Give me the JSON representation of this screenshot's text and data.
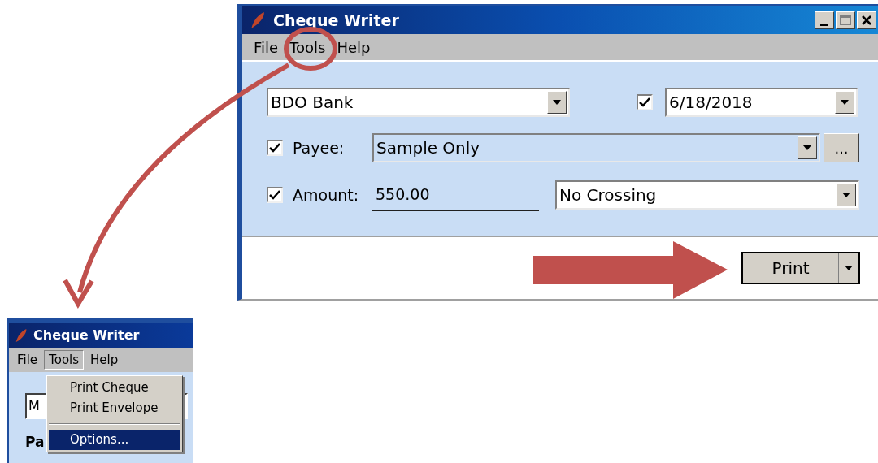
{
  "main_window": {
    "title": "Cheque Writer",
    "menu": [
      {
        "label": "File"
      },
      {
        "label": "Tools"
      },
      {
        "label": "Help"
      }
    ],
    "bank": "BDO Bank",
    "date": {
      "checked": true,
      "value": "6/18/2018"
    },
    "payee": {
      "checked": true,
      "label": "Payee:",
      "value": "Sample Only",
      "browse": "..."
    },
    "amount": {
      "checked": true,
      "label": "Amount:",
      "value": "550.00"
    },
    "crossing": "No Crossing",
    "print_button": "Print"
  },
  "small_window": {
    "title": "Cheque Writer",
    "menu": [
      {
        "label": "File",
        "selected": false
      },
      {
        "label": "Tools",
        "selected": true
      },
      {
        "label": "Help",
        "selected": false
      }
    ],
    "combo": "M",
    "dropdown": [
      {
        "kind": "item",
        "label": "Print Cheque",
        "selected": false
      },
      {
        "kind": "item",
        "label": "Print Envelope",
        "selected": false
      },
      {
        "kind": "separator"
      },
      {
        "kind": "item",
        "label": "Options...",
        "selected": true
      }
    ],
    "payee_label": "Pa"
  }
}
